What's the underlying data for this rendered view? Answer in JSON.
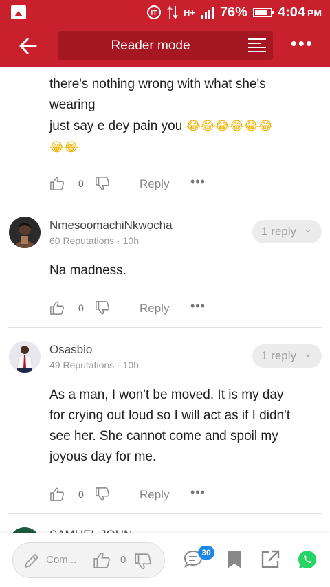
{
  "status_bar": {
    "battery": "76%",
    "time": "4:04",
    "time_suffix": "PM",
    "network": "H+"
  },
  "toolbar": {
    "title": "Reader mode"
  },
  "comments": [
    {
      "text_lines": [
        "there's nothing wrong with what she's",
        "wearing",
        "just say e dey pain you"
      ],
      "emoji_count_line1": 6,
      "emoji_count_line2": 2,
      "likes": "0",
      "reply_label": "Reply"
    },
    {
      "username": "NmesoọmachiNkwọcha",
      "meta": "60 Reputations · 10h",
      "reply_pill": "1 reply",
      "text": "Na madness.",
      "likes": "0",
      "reply_label": "Reply"
    },
    {
      "username": "Osasbio",
      "meta": "49 Reputations · 10h",
      "reply_pill": "1 reply",
      "text_lines": [
        "As a man, I won't be moved. It is my day",
        "for crying out loud so I will act as if I didn't",
        "see her. She cannot come and spoil my",
        "joyous day for me."
      ],
      "likes": "0",
      "reply_label": "Reply"
    },
    {
      "username": "SAMUEL JOHN"
    }
  ],
  "bottom_bar": {
    "composer_placeholder": "Com...",
    "likes": "0",
    "comment_count": "30"
  },
  "colors": {
    "brand_red": "#c8202d",
    "brand_red_dark": "#a51822",
    "badge_blue": "#1e88e5",
    "whatsapp_green": "#25d366"
  }
}
